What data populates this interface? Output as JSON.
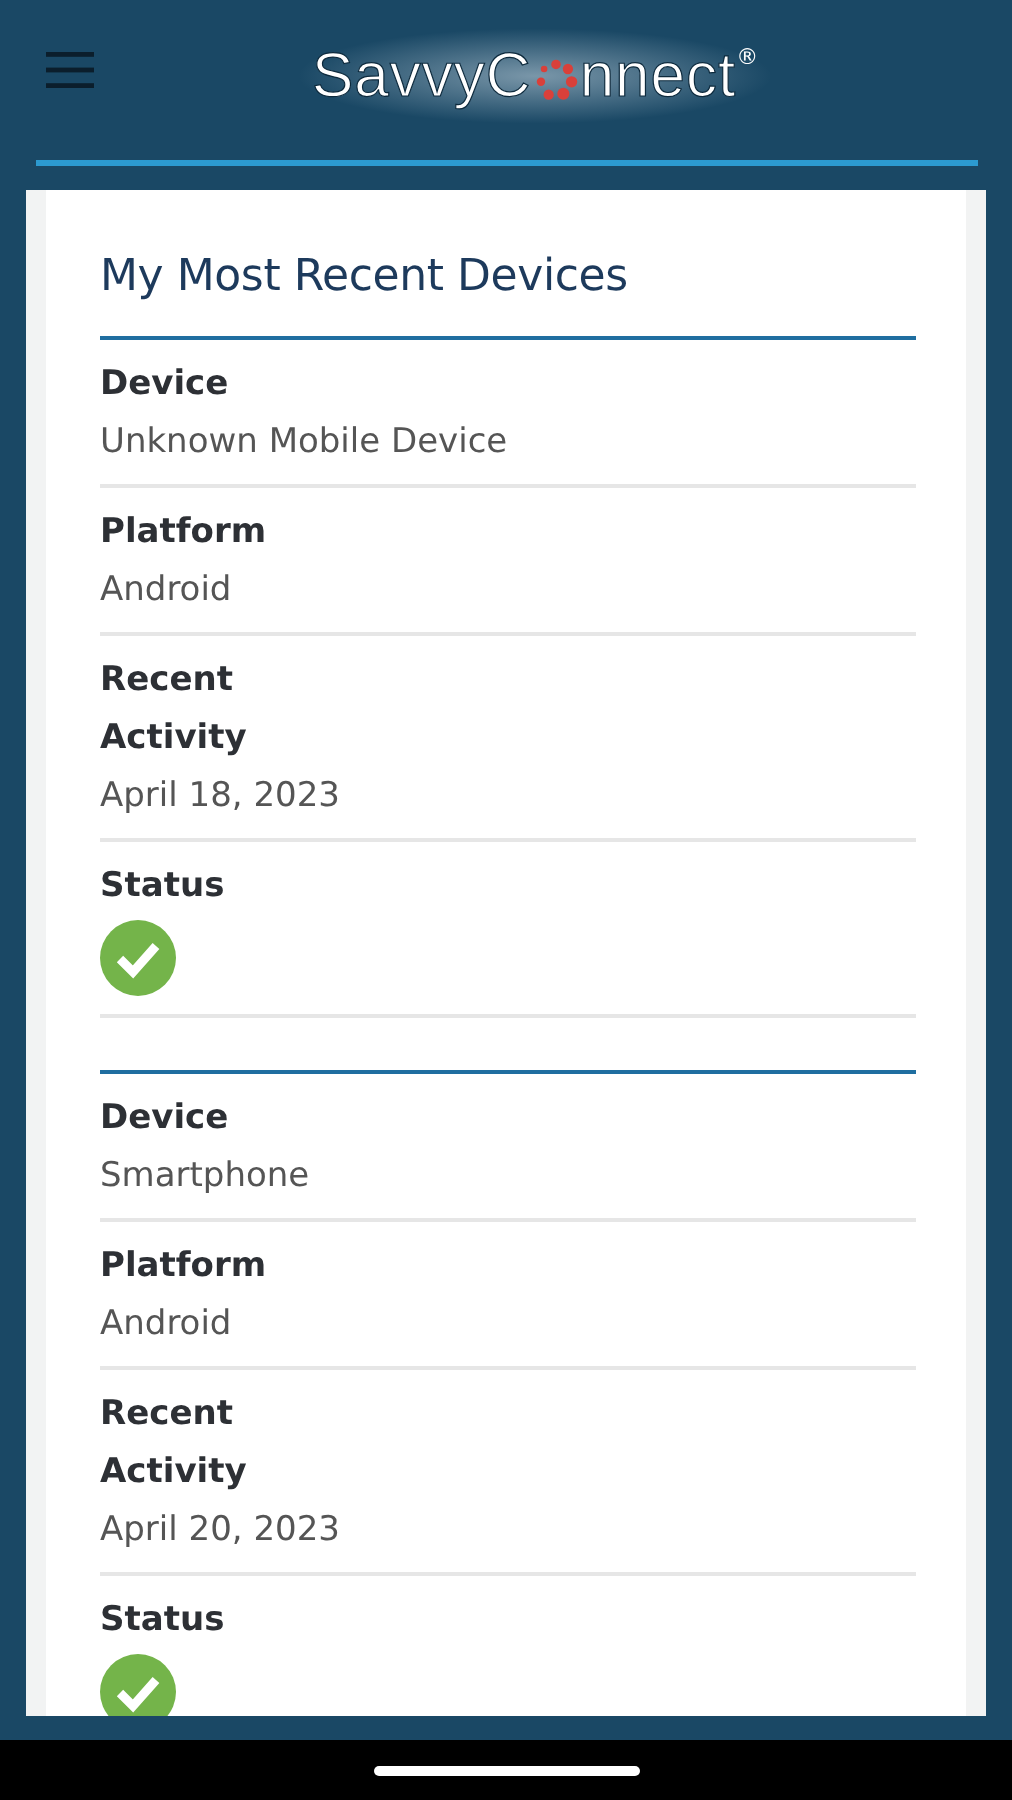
{
  "header": {
    "logo": {
      "before": "SavvyC",
      "after": "nnect",
      "mark": "®"
    }
  },
  "title": "My Most Recent Devices",
  "devices": [
    {
      "fields": [
        {
          "label": "Device",
          "value": "Unknown Mobile Device"
        },
        {
          "label": "Platform",
          "value": "Android"
        },
        {
          "label": "Recent Activity",
          "value": "April 18, 2023"
        }
      ],
      "status": {
        "label": "Status",
        "ok": true
      }
    },
    {
      "fields": [
        {
          "label": "Device",
          "value": "Smartphone"
        },
        {
          "label": "Platform",
          "value": "Android"
        },
        {
          "label": "Recent Activity",
          "value": "April 20, 2023"
        }
      ],
      "status": {
        "label": "Status",
        "ok": true
      }
    }
  ]
}
